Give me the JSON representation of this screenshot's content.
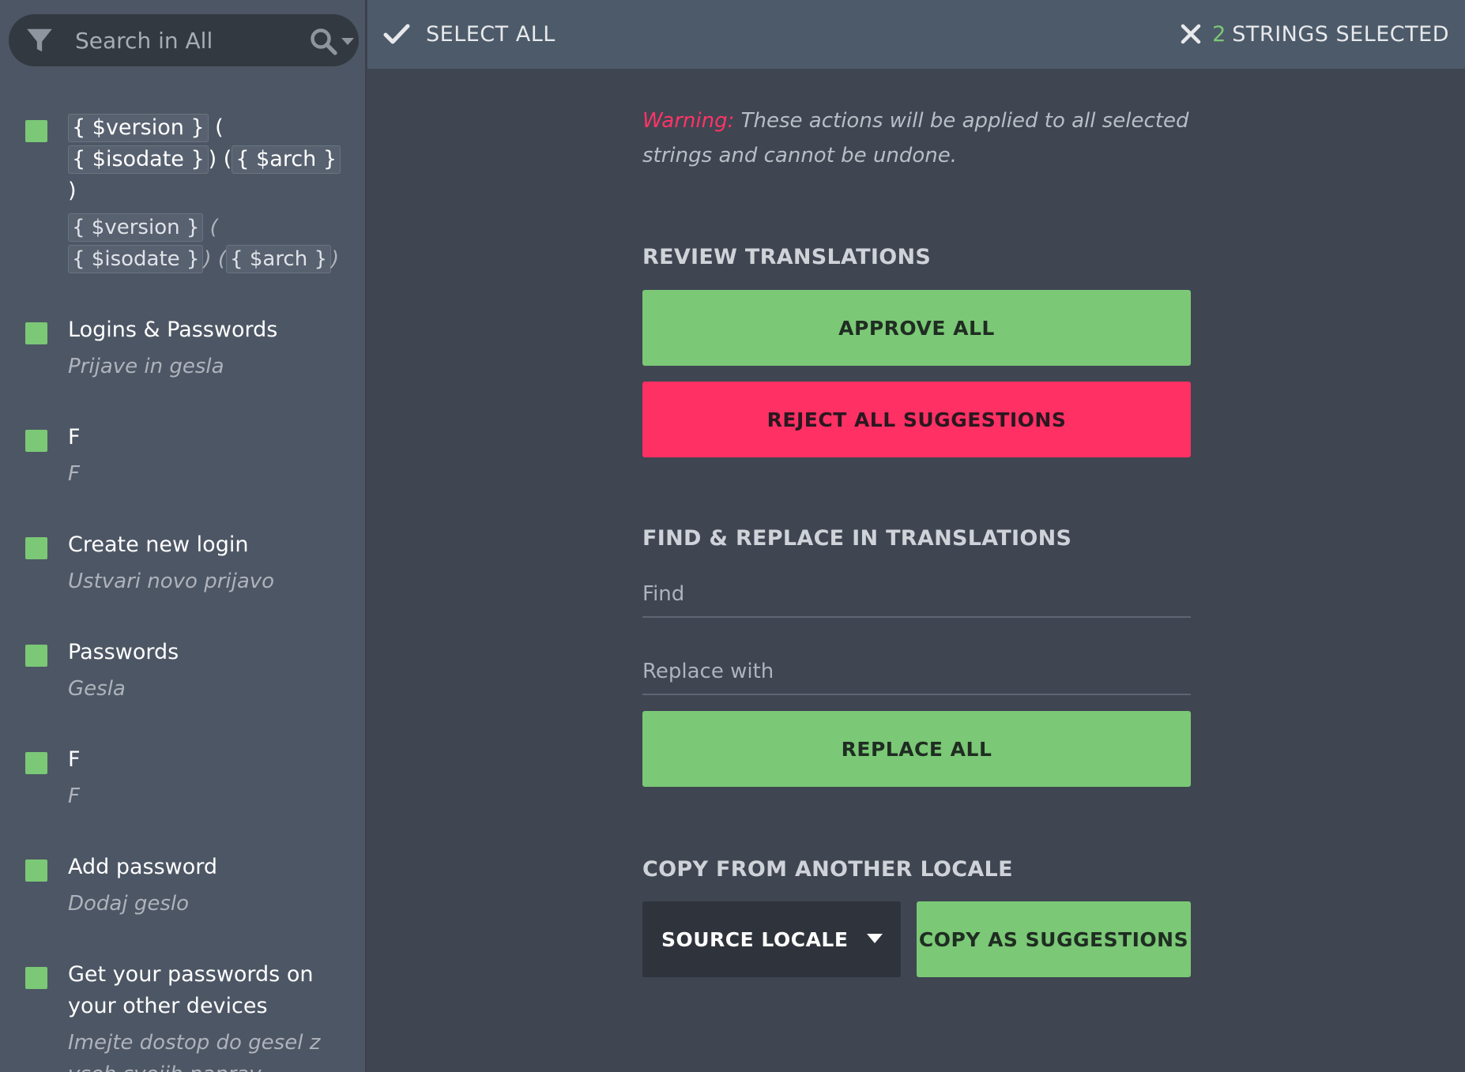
{
  "search": {
    "placeholder": "Search in All"
  },
  "strings": [
    {
      "source_parts": [
        {
          "type": "placeable",
          "text": "{ $version }"
        },
        {
          "type": "text",
          "text": " ("
        },
        {
          "type": "placeable",
          "text": "{ $isodate }"
        },
        {
          "type": "text",
          "text": ") ("
        },
        {
          "type": "placeable",
          "text": "{ $arch }"
        },
        {
          "type": "text",
          "text": ")"
        }
      ],
      "translation_parts": [
        {
          "type": "placeable",
          "text": "{ $version }"
        },
        {
          "type": "text",
          "text": " ("
        },
        {
          "type": "placeable",
          "text": "{ $isodate }"
        },
        {
          "type": "text",
          "text": ") ("
        },
        {
          "type": "placeable",
          "text": "{ $arch }"
        },
        {
          "type": "text",
          "text": ")"
        }
      ]
    },
    {
      "source": "Logins & Passwords",
      "translation": "Prijave in gesla"
    },
    {
      "source": "F",
      "translation": "F"
    },
    {
      "source": "Create new login",
      "translation": "Ustvari novo prijavo"
    },
    {
      "source": "Passwords",
      "translation": "Gesla"
    },
    {
      "source": "F",
      "translation": "F"
    },
    {
      "source": "Add password",
      "translation": "Dodaj geslo"
    },
    {
      "source": "Get your passwords on your other devices",
      "translation": "Imejte dostop do gesel z vseh svojih naprav"
    }
  ],
  "toolbar": {
    "select_all_label": "SELECT ALL",
    "selected_count": "2",
    "selected_label": "STRINGS SELECTED"
  },
  "warning": {
    "label": "Warning:",
    "text": " These actions will be applied to all selected strings and cannot be undone."
  },
  "review": {
    "title": "REVIEW TRANSLATIONS",
    "approve_label": "APPROVE ALL",
    "reject_label": "REJECT ALL SUGGESTIONS"
  },
  "find_replace": {
    "title": "FIND & REPLACE IN TRANSLATIONS",
    "find_placeholder": "Find",
    "find_value": "",
    "replace_placeholder": "Replace with",
    "replace_value": "",
    "replace_all_label": "REPLACE ALL"
  },
  "copy_locale": {
    "title": "COPY FROM ANOTHER LOCALE",
    "locale_label": "SOURCE LOCALE",
    "copy_label": "COPY AS SUGGESTIONS"
  },
  "colors": {
    "green": "#7bc876",
    "red": "#ff3064",
    "warning_text": "#ff3466",
    "background": "#3f4551",
    "sidebar": "#4d5664",
    "toolbar": "#4d5a69"
  },
  "icons": {
    "filter": "filter-icon",
    "search": "search-icon",
    "select_all": "check-icon",
    "close": "close-icon",
    "dropdown": "chevron-down-icon"
  }
}
